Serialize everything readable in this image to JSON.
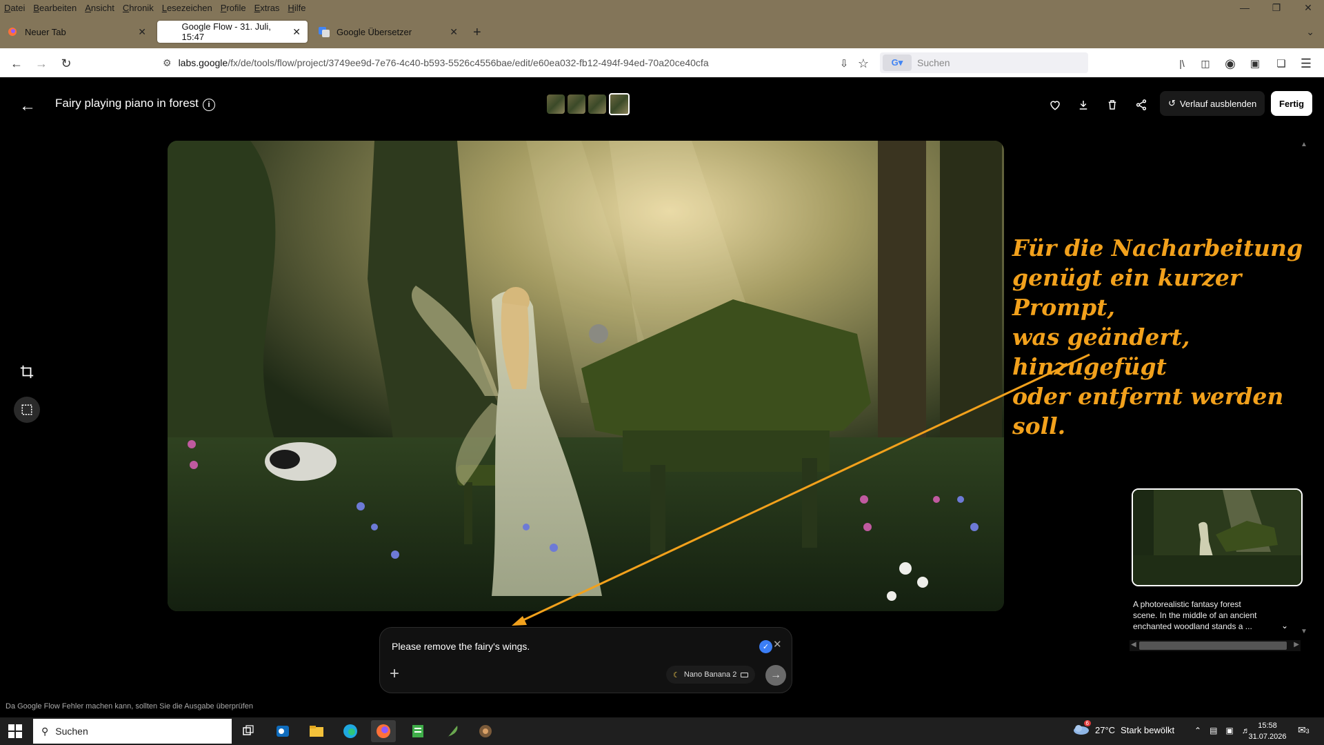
{
  "browser": {
    "menu": [
      "Datei",
      "Bearbeiten",
      "Ansicht",
      "Chronik",
      "Lesezeichen",
      "Profile",
      "Extras",
      "Hilfe"
    ],
    "tabs": [
      {
        "label": "Neuer Tab",
        "icon": "firefox-icon",
        "active": false
      },
      {
        "label": "Google Flow - 31. Juli, 15:47",
        "icon": "flow-icon",
        "active": true
      },
      {
        "label": "Google Übersetzer",
        "icon": "translate-icon",
        "active": false
      }
    ],
    "url_host": "labs.google",
    "url_path": "/fx/de/tools/flow/project/3749ee9d-7e76-4c40-b593-5526c4556bae/edit/e60ea032-fb12-494f-94ed-70a20ce40cfa",
    "search_placeholder": "Suchen"
  },
  "app": {
    "title": "Fairy playing piano in forest",
    "history_button": "Verlauf ausblenden",
    "done_button": "Fertig",
    "annotation": "Für die Nacharbeitung\ngenügt ein kurzer Prompt,\nwas geändert, hinzugefügt\noder entfernt werden soll.",
    "annotation_color": "#f2a11c",
    "side_description": "A photorealistic fantasy forest scene. In the middle of an ancient enchanted woodland stands a ...",
    "prompt": {
      "text": "Please remove the fairy's wings.",
      "model": "Nano Banana 2"
    },
    "disclaimer": "Da Google Flow Fehler machen kann, sollten Sie die Ausgabe überprüfen"
  },
  "taskbar": {
    "search": "Suchen",
    "weather_temp": "27°C",
    "weather_text": "Stark bewölkt",
    "weather_badge": "6",
    "time": "15:58",
    "date": "31.07.2026",
    "notif_count": "3"
  }
}
